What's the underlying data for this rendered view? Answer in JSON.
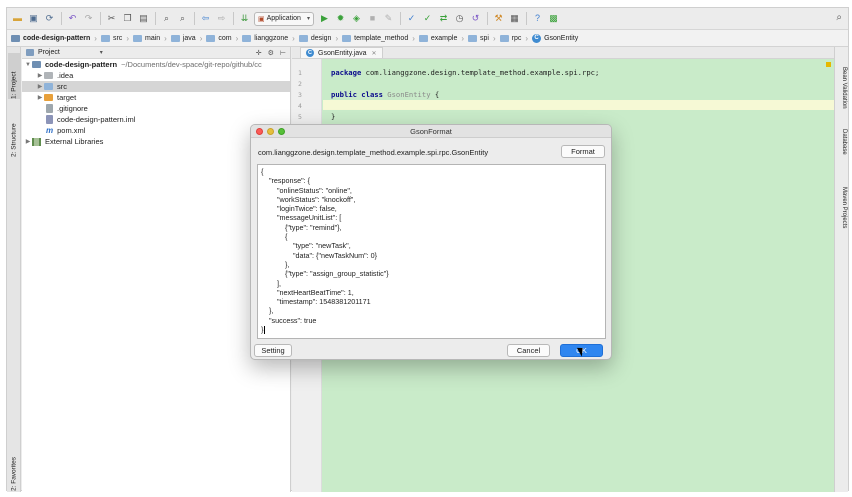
{
  "toolbar": {
    "icons": [
      "open-icon",
      "save-icon",
      "sync-icon",
      "undo-icon",
      "redo-icon",
      "cut-icon",
      "copy-icon",
      "paste-icon",
      "find-icon",
      "replace-icon",
      "back-icon",
      "forward-icon",
      "build-icon",
      "run-icon",
      "debug-icon",
      "coverage-icon",
      "stop-icon",
      "attach-icon",
      "vcs-update-icon",
      "vcs-commit-icon",
      "vcs-compare-icon",
      "vcs-history-icon",
      "revert-icon",
      "settings-icon",
      "project-structure-icon",
      "help-icon",
      "sdk-icon",
      "search-everywhere-icon"
    ],
    "run_config": "Application"
  },
  "breadcrumb": [
    "code-design-pattern",
    "src",
    "main",
    "java",
    "com",
    "lianggzone",
    "design",
    "template_method",
    "example",
    "spi",
    "rpc",
    "GsonEntity"
  ],
  "left_tabs": {
    "project": "1: Project",
    "structure": "2: Structure",
    "favorites": "2: Favorites"
  },
  "right_tabs": {
    "maven": "Maven Projects",
    "database": "Database",
    "bean_validation": "Bean Validation"
  },
  "project_panel": {
    "title": "Project",
    "root_name": "code-design-pattern",
    "root_path": "~/Documents/dev-space/git-repo/github/cc",
    "items": [
      ".idea",
      "src",
      "target",
      ".gitignore",
      "code-design-pattern.iml",
      "pom.xml",
      "External Libraries"
    ]
  },
  "editor": {
    "tab_label": "GsonEntity.java",
    "line_numbers": [
      "1",
      "2",
      "3",
      "4",
      "5"
    ],
    "line1_kw": "package",
    "line1_rest": " com.lianggzone.design.template_method.example.spi.rpc;",
    "line3_kw1": "public",
    "line3_kw2": "class",
    "line3_name": "GsonEntity",
    "line3_brace": " {",
    "line5": "}"
  },
  "dialog": {
    "title": "GsonFormat",
    "class_name": "com.lianggzone.design.template_method.example.spi.rpc.GsonEntity",
    "format_button": "Format",
    "json_lines": [
      "{",
      "    \"response\": {",
      "        \"onlineStatus\": \"online\",",
      "        \"workStatus\": \"knockoff\",",
      "        \"loginTwice\": false,",
      "        \"messageUnitList\": [",
      "            {\"type\": \"remind\"},",
      "            {",
      "                \"type\": \"newTask\",",
      "                \"data\": {\"newTaskNum\": 0}",
      "            },",
      "            {\"type\": \"assign_group_statistic\"}",
      "        ],",
      "        \"nextHeartBeatTime\": 1,",
      "        \"timestamp\": 1548381201171",
      "    },",
      "    \"success\": true",
      "}"
    ],
    "setting_button": "Setting",
    "cancel_button": "Cancel",
    "ok_button": "OK"
  }
}
